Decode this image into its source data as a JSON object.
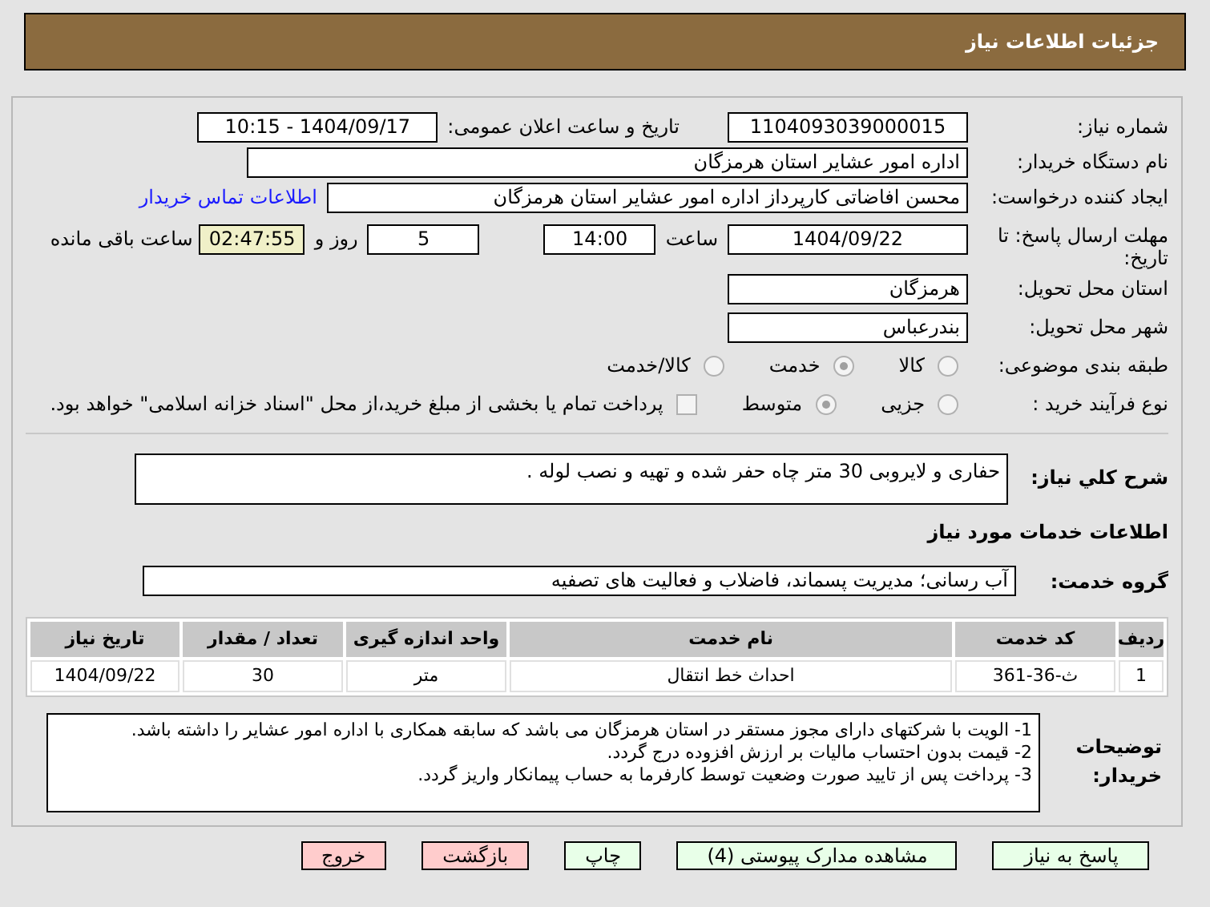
{
  "header": {
    "title": "جزئیات اطلاعات نیاز"
  },
  "need_number": {
    "label": "شماره نیاز:",
    "value": "1104093039000015"
  },
  "announce": {
    "label": "تاریخ و ساعت اعلان عمومی:",
    "value": "1404/09/17 - 10:15"
  },
  "buyer_org": {
    "label": "نام دستگاه خریدار:",
    "value": "اداره امور عشایر استان هرمزگان"
  },
  "creator": {
    "label": "ایجاد کننده درخواست:",
    "value": "محسن افاضاتی کارپرداز اداره امور عشایر استان هرمزگان",
    "link": "اطلاعات تماس خریدار"
  },
  "deadline": {
    "label": "مهلت ارسال پاسخ: تا تاریخ:",
    "date": "1404/09/22",
    "time_label": "ساعت",
    "time": "14:00",
    "days": "5",
    "days_label": "روز و",
    "remaining": "02:47:55",
    "remaining_label": "ساعت باقی مانده"
  },
  "province": {
    "label": "استان محل تحویل:",
    "value": "هرمزگان"
  },
  "city": {
    "label": "شهر محل تحویل:",
    "value": "بندرعباس"
  },
  "category": {
    "label": "طبقه بندی موضوعی:",
    "options": [
      {
        "label": "کالا",
        "selected": false
      },
      {
        "label": "خدمت",
        "selected": true
      },
      {
        "label": "کالا/خدمت",
        "selected": false
      }
    ]
  },
  "purchase_type": {
    "label": "نوع فرآیند خرید :",
    "options": [
      {
        "label": "جزیی",
        "selected": false
      },
      {
        "label": "متوسط",
        "selected": true
      }
    ],
    "checkbox": {
      "checked": false,
      "label": "پرداخت تمام یا بخشی از مبلغ خرید،از محل \"اسناد خزانه اسلامی\" خواهد بود."
    }
  },
  "description": {
    "label": "شرح کلي نیاز:",
    "value": "حفاری و لایروبی 30 متر چاه حفر شده و تهیه و نصب لوله ."
  },
  "services_title": "اطلاعات خدمات مورد نیاز",
  "service_group": {
    "label": "گروه خدمت:",
    "value": "آب رسانی؛ مدیریت پسماند، فاضلاب و فعالیت های تصفیه"
  },
  "table": {
    "columns": [
      "ردیف",
      "کد خدمت",
      "نام خدمت",
      "واحد اندازه گیری",
      "تعداد / مقدار",
      "تاریخ نیاز"
    ],
    "rows": [
      [
        "1",
        "ث-36-361",
        "احداث خط انتقال",
        "متر",
        "30",
        "1404/09/22"
      ]
    ]
  },
  "buyer_notes": {
    "label": "توضیحات خریدار:",
    "lines": [
      "1- الویت با شرکتهای دارای مجوز مستقر در استان هرمزگان می باشد که سابقه همکاری با اداره امور عشایر را داشته باشد.",
      "2- قیمت بدون احتساب مالیات بر ارزش افزوده درج گردد.",
      "3- پرداخت پس از تایید صورت وضعیت توسط کارفرما به حساب پیمانکار واریز گردد."
    ]
  },
  "buttons": [
    {
      "label": "پاسخ به نیاز",
      "kind": "normal"
    },
    {
      "label": "مشاهده مدارک پیوستی (4)",
      "kind": "normal"
    },
    {
      "label": "چاپ",
      "kind": "normal"
    },
    {
      "label": "بازگشت",
      "kind": "danger"
    },
    {
      "label": "خروج",
      "kind": "danger"
    }
  ]
}
